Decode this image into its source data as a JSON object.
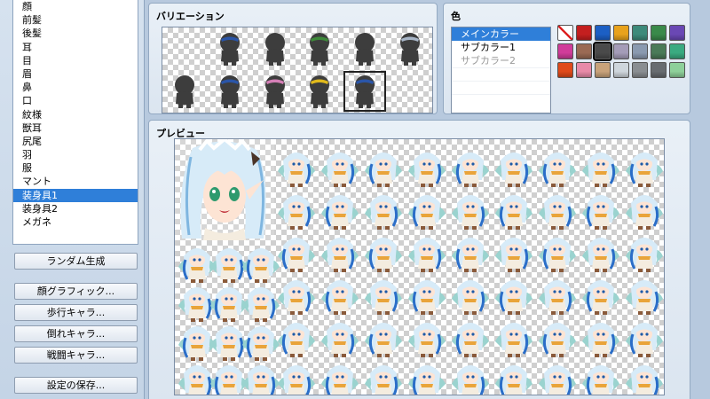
{
  "parts_list": {
    "items": [
      {
        "label": "顔"
      },
      {
        "label": "前髪"
      },
      {
        "label": "後髪"
      },
      {
        "label": "耳"
      },
      {
        "label": "目"
      },
      {
        "label": "眉"
      },
      {
        "label": "鼻"
      },
      {
        "label": "口"
      },
      {
        "label": "紋様"
      },
      {
        "label": "獣耳"
      },
      {
        "label": "尻尾"
      },
      {
        "label": "羽"
      },
      {
        "label": "服"
      },
      {
        "label": "マント"
      },
      {
        "label": "装身具1"
      },
      {
        "label": "装身具2"
      },
      {
        "label": "メガネ"
      }
    ],
    "selected_index": 14
  },
  "side_buttons": {
    "random": "ランダム生成",
    "face": "顔グラフィック...",
    "walk": "歩行キャラ...",
    "down": "倒れキャラ...",
    "battle": "戦闘キャラ...",
    "save": "設定の保存..."
  },
  "variation_panel": {
    "title": "バリエーション",
    "cells": [
      {
        "icon": "empty-variation-icon",
        "accent": ""
      },
      {
        "icon": "character-silhouette-icon",
        "accent": "#2a55a8"
      },
      {
        "icon": "character-silhouette-icon",
        "accent": ""
      },
      {
        "icon": "character-silhouette-icon",
        "accent": "#3e8a3a"
      },
      {
        "icon": "character-silhouette-icon",
        "accent": ""
      },
      {
        "icon": "character-silhouette-icon",
        "accent": "#a8b6c8"
      },
      {
        "icon": "character-silhouette-icon",
        "accent": ""
      },
      {
        "icon": "character-silhouette-icon",
        "accent": "#2a55a8"
      },
      {
        "icon": "character-silhouette-icon",
        "accent": "#d57fb6"
      },
      {
        "icon": "character-silhouette-icon",
        "accent": "#e0b91c"
      },
      {
        "icon": "character-silhouette-icon",
        "accent": "#2a55a8"
      },
      {
        "icon": "empty-variation-icon",
        "accent": ""
      }
    ],
    "selected_index": 10
  },
  "color_panel": {
    "title": "色",
    "slots": [
      {
        "label": "メインカラー",
        "state": "selected"
      },
      {
        "label": "サブカラー1",
        "state": "normal"
      },
      {
        "label": "サブカラー2",
        "state": "disabled"
      }
    ],
    "swatches": [
      "none",
      "#c41f1f",
      "#1c5fc4",
      "#e8a21c",
      "#3d8a7a",
      "#3a8a4a",
      "#6a48b4",
      "#d03c9a",
      "#9a6a54",
      "#4a4a4a",
      "#a49cb8",
      "#8a9ab0",
      "#4a7a58",
      "#3aaa80",
      "#e04a1a",
      "#e88aa8",
      "#c8a27a",
      "#cfd6dc",
      "#8a8e92",
      "#686c70",
      "#8ed09a"
    ],
    "selected_swatch": 9
  },
  "preview_panel": {
    "title": "プレビュー",
    "hair_color": "#d7ebf8",
    "hair_shade": "#7fb6e0",
    "outfit_color": "#f4ecdf",
    "wing_color": "#9ad3cf",
    "accent_blue": "#2b6ec8"
  }
}
